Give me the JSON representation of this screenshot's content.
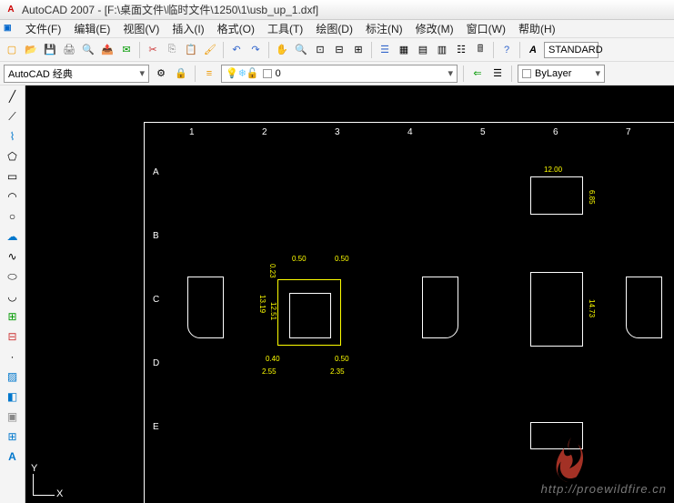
{
  "title": "AutoCAD 2007 - [F:\\桌面文件\\临时文件\\1250\\1\\usb_up_1.dxf]",
  "menu": {
    "items": [
      "文件(F)",
      "编辑(E)",
      "视图(V)",
      "插入(I)",
      "格式(O)",
      "工具(T)",
      "绘图(D)",
      "标注(N)",
      "修改(M)",
      "窗口(W)",
      "帮助(H)"
    ]
  },
  "workspace_combo": "AutoCAD 经典",
  "layer_combo": "0",
  "bylayer_combo": "ByLayer",
  "textstyle": "STANDARD",
  "ruler": {
    "cols": [
      "1",
      "2",
      "3",
      "4",
      "5",
      "6",
      "7"
    ],
    "rows": [
      "A",
      "B",
      "C",
      "D",
      "E"
    ]
  },
  "dims": {
    "d1": "12.00",
    "d2": "6.85",
    "d3": "0.23",
    "d4": "0.50",
    "d5": "0.50",
    "d6": "13.19",
    "d7": "12.51",
    "d8": "0.40",
    "d9": "2.55",
    "d10": "0.50",
    "d11": "2.35",
    "d12": "14.73"
  },
  "ucs_x": "X",
  "ucs_y": "Y",
  "watermark": "http://proewildfire.cn"
}
